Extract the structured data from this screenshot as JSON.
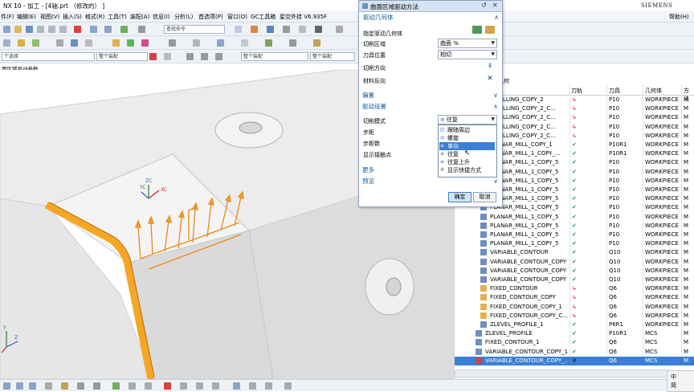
{
  "window": {
    "title": "NX 10 - 加工 - [4轴.prt （修改的） ]",
    "brand": "SIEMENS"
  },
  "menu": [
    "件(F)",
    "编辑(E)",
    "视图(V)",
    "插入(S)",
    "格式(R)",
    "工具(T)",
    "装配(A)",
    "信息(I)",
    "分析(L)",
    "首选项(P)",
    "窗口(O)",
    "GC工具箱",
    "星空外挂 V6.935F",
    "帮助(H)"
  ],
  "toolbar": {
    "search_command": "查找命令",
    "filter_left": "个选择",
    "filter_mid": "整个装配",
    "filter_right": "整个装配"
  },
  "viewport": {
    "label": "面区域驱动参数",
    "axis_x": "XC",
    "axis_y": "YC",
    "axis_z": "ZC",
    "corner_axis_y": "Y",
    "corner_axis_z": "Z"
  },
  "dialog": {
    "title": "曲面区域驱动方法",
    "sections": {
      "drive_geometry": "驱动几何体",
      "offset": "偏置",
      "drive_settings": "驱动设置",
      "more": "更多",
      "preview": "预览"
    },
    "fields": {
      "specify_drive_geometry": "指定驱动几何体",
      "cut_region": "切削区域",
      "cut_region_value": "曲面 %",
      "tool_position": "刀具位置",
      "tool_position_value": "相切",
      "cut_direction": "切削方向",
      "material_reverse": "材料反向",
      "cut_pattern": "切削模式",
      "cut_pattern_value": "往复",
      "stepover": "步距",
      "stepover_count": "步距数",
      "show_contact_points": "显示接触点"
    },
    "dropdown_options": [
      "跟随周边",
      "螺旋",
      "单向",
      "往复",
      "往复上升",
      "显示快捷方式"
    ],
    "highlighted_option": "单向",
    "buttons": {
      "ok": "确定",
      "cancel": "取消"
    }
  },
  "nav": {
    "header_partial": "几何",
    "columns": [
      "刀轨",
      "刀具",
      "几何体",
      "方法"
    ],
    "rows": [
      {
        "name": "E_MILLING_COPY_2",
        "path": "re",
        "tool": "P10",
        "geom": "WORKPIECE",
        "method": "M"
      },
      {
        "name": "E_MILLING_COPY_2_C...",
        "path": "re",
        "tool": "P10",
        "geom": "WORKPIECE",
        "method": "M"
      },
      {
        "name": "E_MILLING_COPY_2_C...",
        "path": "re",
        "tool": "P10",
        "geom": "WORKPIECE",
        "method": "M"
      },
      {
        "name": "E_MILLING_COPY_2_C...",
        "path": "re",
        "tool": "P10",
        "geom": "WORKPIECE",
        "method": "M"
      },
      {
        "name": "E_MILLING_COPY_2_C...",
        "path": "re",
        "tool": "P10",
        "geom": "WORKPIECE",
        "method": "M"
      },
      {
        "name": "PLANAR_MILL_COPY_1",
        "path": "ok",
        "tool": "P10R1",
        "geom": "WORKPIECE",
        "method": "M"
      },
      {
        "name": "PLANAR_MILL_1_COPY_...",
        "path": "ok",
        "tool": "P10R1",
        "geom": "WORKPIECE",
        "method": "M"
      },
      {
        "name": "PLANAR_MILL_1_COPY_5",
        "path": "ok",
        "tool": "P10",
        "geom": "WORKPIECE",
        "method": "M"
      },
      {
        "name": "PLANAR_MILL_1_COPY_5",
        "path": "ok",
        "tool": "P10",
        "geom": "WORKPIECE",
        "method": "M"
      },
      {
        "name": "PLANAR_MILL_1_COPY_5",
        "path": "ok",
        "tool": "P10",
        "geom": "WORKPIECE",
        "method": "M"
      },
      {
        "name": "PLANAR_MILL_1_COPY_5",
        "path": "ok",
        "tool": "P10",
        "geom": "WORKPIECE",
        "method": "M"
      },
      {
        "name": "PLANAR_MILL_1_COPY_5",
        "path": "ok",
        "tool": "P10",
        "geom": "WORKPIECE",
        "method": "M"
      },
      {
        "name": "PLANAR_MILL_1_COPY_5",
        "path": "ok",
        "tool": "P10",
        "geom": "WORKPIECE",
        "method": "M"
      },
      {
        "name": "PLANAR_MILL_1_COPY_5",
        "path": "ok",
        "tool": "P10",
        "geom": "WORKPIECE",
        "method": "M"
      },
      {
        "name": "PLANAR_MILL_1_COPY_5",
        "path": "ok",
        "tool": "P10",
        "geom": "WORKPIECE",
        "method": "M"
      },
      {
        "name": "PLANAR_MILL_1_COPY_5",
        "path": "ok",
        "tool": "P10",
        "geom": "WORKPIECE",
        "method": "M"
      },
      {
        "name": "PLANAR_MILL_1_COPY_5",
        "path": "ok",
        "tool": "P10",
        "geom": "WORKPIECE",
        "method": "M"
      },
      {
        "name": "VARIABLE_CONTOUR",
        "path": "ok",
        "tool": "Q10",
        "geom": "WORKPIECE",
        "method": "M"
      },
      {
        "name": "VARIABLE_CONTOUR_COPY",
        "path": "ok",
        "tool": "Q10",
        "geom": "WORKPIECE",
        "method": "M"
      },
      {
        "name": "VARIABLE_CONTOUR_COPY",
        "path": "ok",
        "tool": "Q10",
        "geom": "WORKPIECE",
        "method": "M"
      },
      {
        "name": "VARIABLE_CONTOUR_COPY",
        "path": "ok",
        "tool": "Q10",
        "geom": "WORKPIECE",
        "method": "M"
      },
      {
        "name": "FIXED_CONTOUR",
        "path": "re",
        "tool": "Q6",
        "geom": "WORKPIECE",
        "method": "M"
      },
      {
        "name": "FIXED_CONTOUR_COPY",
        "path": "re",
        "tool": "Q6",
        "geom": "WORKPIECE",
        "method": "M"
      },
      {
        "name": "FIXED_CONTOUR_COPY_1",
        "path": "re",
        "tool": "Q6",
        "geom": "WORKPIECE",
        "method": "M"
      },
      {
        "name": "FIXED_CONTOUR_COPY_C...",
        "path": "re",
        "tool": "Q6",
        "geom": "WORKPIECE",
        "method": "M"
      },
      {
        "name": "ZLEVEL_PROFILE_1",
        "path": "ok",
        "tool": "P6R1",
        "geom": "WORKPIECE",
        "method": "M"
      },
      {
        "name": "ZLEVEL_PROFILE",
        "path": "ok",
        "tool": "P10R1",
        "geom": "MCS",
        "method": "M"
      },
      {
        "name": "FIXED_CONTOUR_1",
        "path": "ok",
        "tool": "Q6",
        "geom": "MCS",
        "method": "M"
      },
      {
        "name": "VARIABLE_CONTOUR_COPY_1",
        "path": "ok",
        "tool": "Q6",
        "geom": "MCS",
        "method": "M"
      },
      {
        "name": "VARIABLE_CONTOUR_COPY_...",
        "path": "x",
        "tool": "Q6",
        "geom": "MCS",
        "method": "M",
        "selected": true
      }
    ]
  },
  "ime": {
    "line1": "中",
    "line2": "简"
  },
  "colors": {
    "accent": "#0a5aa8",
    "selection": "#3a7fd5",
    "edge_highlight": "#f5a623",
    "path_ok": "#1e9e2a",
    "path_regen": "#c2188b"
  }
}
